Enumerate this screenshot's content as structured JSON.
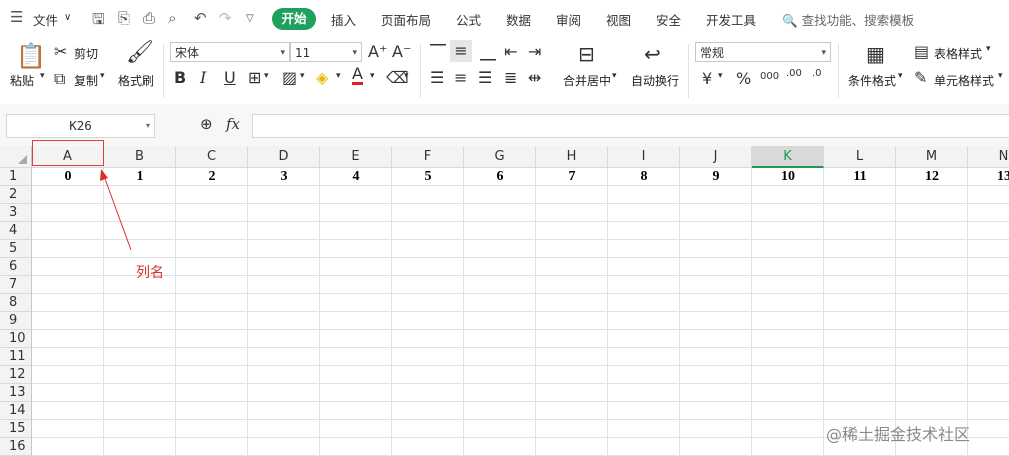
{
  "menu": {
    "file_label": "文件",
    "tabs": [
      "开始",
      "插入",
      "页面布局",
      "公式",
      "数据",
      "审阅",
      "视图",
      "安全",
      "开发工具"
    ],
    "search_placeholder": "查找功能、搜索模板"
  },
  "ribbon": {
    "paste": "粘贴",
    "cut": "剪切",
    "copy": "复制",
    "format_painter": "格式刷",
    "font_name": "宋体",
    "font_size": "11",
    "bold": "B",
    "italic": "I",
    "underline": "U",
    "merge_center": "合并居中",
    "wrap_text": "自动换行",
    "number_format": "常规",
    "currency": "¥",
    "percent": "%",
    "thousands": "000",
    "inc_decimal": ".00",
    "dec_decimal": ".0",
    "conditional_format": "条件格式",
    "table_style": "表格样式",
    "cell_style": "单元格样式"
  },
  "formula_bar": {
    "name_box": "K26",
    "fx": "fx",
    "formula": ""
  },
  "sheet": {
    "columns": [
      "A",
      "B",
      "C",
      "D",
      "E",
      "F",
      "G",
      "H",
      "I",
      "J",
      "K",
      "L",
      "M",
      "N"
    ],
    "selected_column": "K",
    "rows": [
      "1",
      "2",
      "3",
      "4",
      "5",
      "6",
      "7",
      "8",
      "9",
      "10",
      "11",
      "12",
      "13",
      "14",
      "15",
      "16"
    ],
    "row1_values": [
      "0",
      "1",
      "2",
      "3",
      "4",
      "5",
      "6",
      "7",
      "8",
      "9",
      "10",
      "11",
      "12",
      "13"
    ]
  },
  "annotation": {
    "label": "列名",
    "color": "#d9302c"
  },
  "watermark": "@稀土掘金技术社区",
  "colors": {
    "accent": "#1fa05f",
    "selected_col_text": "#1a9a55"
  }
}
